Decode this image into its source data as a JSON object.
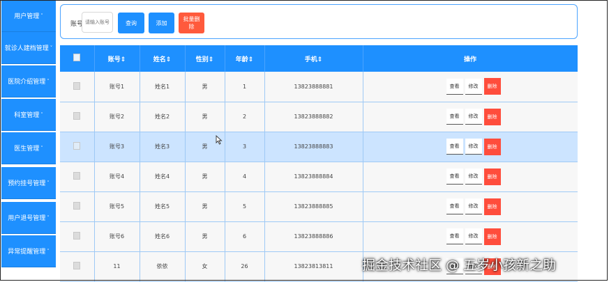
{
  "sidebar": {
    "items": [
      {
        "label": "用户管理"
      },
      {
        "label": "就诊人建档管理"
      },
      {
        "label": "医院介绍管理"
      },
      {
        "label": "科室管理"
      },
      {
        "label": "医生管理"
      },
      {
        "label": "预约挂号管理"
      },
      {
        "label": "用户退号管理"
      },
      {
        "label": "异常提醒管理"
      }
    ],
    "caret": "˅"
  },
  "search": {
    "label": "账号",
    "placeholder": "请输入账号",
    "query_label": "查询",
    "add_label": "添加",
    "batch_delete_label": "批量删除"
  },
  "table": {
    "columns": [
      "",
      "账号⇕",
      "姓名⇕",
      "性别⇕",
      "年龄⇕",
      "手机⇕",
      "操作"
    ],
    "rows": [
      {
        "account": "账号1",
        "name": "姓名1",
        "gender": "男",
        "age": "1",
        "phone": "13823888881"
      },
      {
        "account": "账号2",
        "name": "姓名2",
        "gender": "男",
        "age": "2",
        "phone": "13823888882"
      },
      {
        "account": "账号3",
        "name": "姓名3",
        "gender": "男",
        "age": "3",
        "phone": "13823888883"
      },
      {
        "account": "账号4",
        "name": "姓名4",
        "gender": "男",
        "age": "4",
        "phone": "13823888884"
      },
      {
        "account": "账号5",
        "name": "姓名5",
        "gender": "男",
        "age": "5",
        "phone": "13823888885"
      },
      {
        "account": "账号6",
        "name": "姓名6",
        "gender": "男",
        "age": "6",
        "phone": "13823888886"
      },
      {
        "account": "11",
        "name": "依依",
        "gender": "女",
        "age": "26",
        "phone": "13823813811"
      }
    ],
    "actions": {
      "view": "查看",
      "edit": "修改",
      "delete": "删除"
    }
  },
  "colors": {
    "primary": "#1e90ff",
    "danger": "#ff4d3c",
    "selected_row": "#cce4ff"
  },
  "watermark": "掘金技术社区 @ 五岁小孩新之助"
}
